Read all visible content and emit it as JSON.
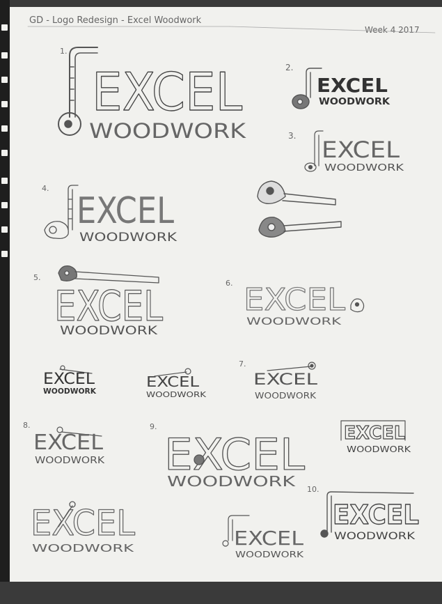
{
  "header": {
    "title": "GD - Logo Redesign - Excel Woodwork",
    "date": "Week 4 2017"
  },
  "numbers": [
    "1.",
    "2.",
    "3.",
    "4.",
    "5.",
    "6.",
    "7.",
    "8.",
    "9.",
    "10."
  ],
  "logo_word": "EXCEL",
  "logo_subword": "WOODWORK",
  "colors": {
    "paper": "#f1f1ee",
    "pencil": "#555555",
    "binder": "#1e1e1e",
    "background": "#3a3a3a"
  }
}
